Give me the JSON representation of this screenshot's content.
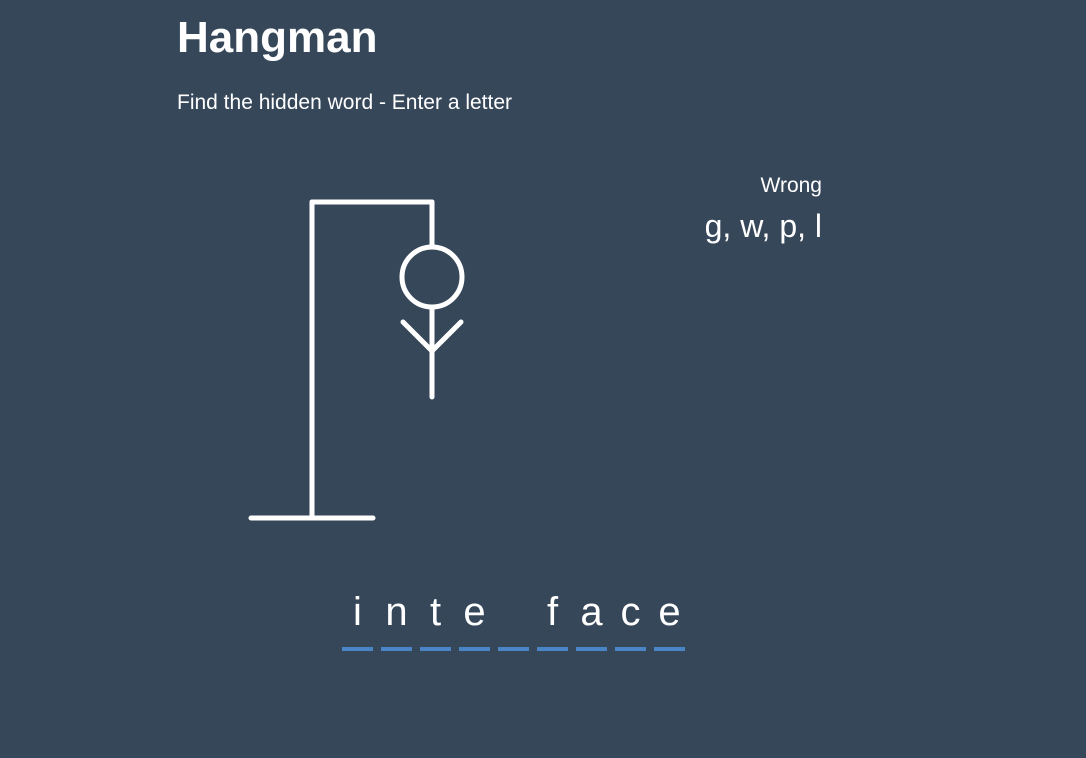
{
  "header": {
    "title": "Hangman",
    "subtitle": "Find the hidden word - Enter a letter"
  },
  "wrong": {
    "label": "Wrong",
    "letters": "g, w, p, l"
  },
  "word": {
    "letters": [
      "i",
      "n",
      "t",
      "e",
      "",
      "f",
      "a",
      "c",
      "e"
    ]
  },
  "figure": {
    "parts_shown": [
      "gallows-base",
      "gallows-pole",
      "gallows-top",
      "rope",
      "head",
      "body",
      "left-arm",
      "right-arm"
    ]
  },
  "colors": {
    "background": "#37475a",
    "foreground": "#ffffff",
    "accent": "#4a86c5"
  }
}
